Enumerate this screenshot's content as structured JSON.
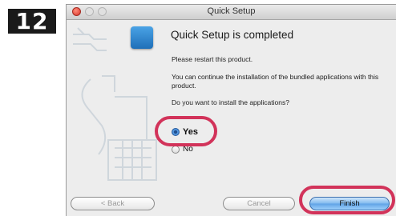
{
  "step": "12",
  "window": {
    "title": "Quick Setup"
  },
  "content": {
    "heading": "Quick Setup is completed",
    "restart_text": "Please restart this product.",
    "continue_text": "You can continue the installation of the bundled applications with this product.",
    "question": "Do you want to install the applications?"
  },
  "options": [
    {
      "label": "Yes",
      "selected": true
    },
    {
      "label": "No",
      "selected": false
    }
  ],
  "buttons": {
    "back": "< Back",
    "cancel": "Cancel",
    "finish": "Finish"
  },
  "colors": {
    "highlight": "#d2335a",
    "accent": "#2f74c8"
  },
  "icons": {
    "window": "quick-setup-app-icon",
    "illustration": "cable-keyboard-illustration"
  }
}
